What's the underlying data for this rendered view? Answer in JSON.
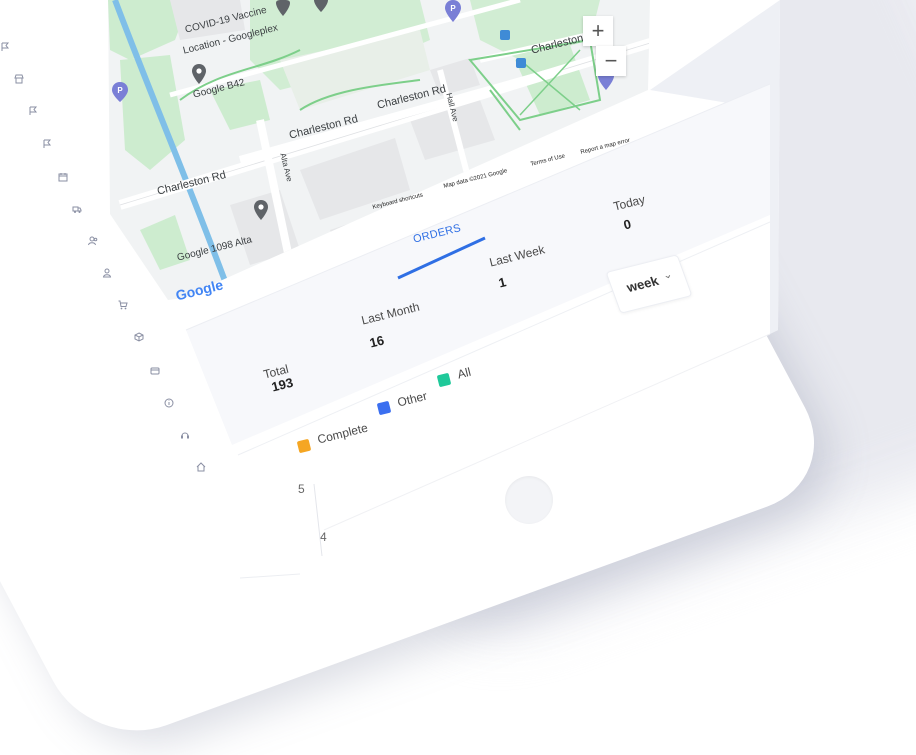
{
  "map": {
    "labels": {
      "covid_vaccine": "COVID-19 Vaccine",
      "location_googleplex": "Location - Googleplex",
      "google_b42": "Google B42",
      "charleston_rd_1": "Charleston Rd",
      "charleston_rd_2": "Charleston Rd",
      "charleston_rd_3": "Charleston Rd",
      "charleston_rd_4": "Charleston",
      "alta_ave": "Alta Ave",
      "hall_ave": "Hall Ave",
      "google_1098_alta": "Google 1098 Alta",
      "google_logo": "Google",
      "keyboard_shortcuts": "Keyboard shortcuts",
      "map_data": "Map data ©2021 Google",
      "terms_of_use": "Terms of Use",
      "report_map_error": "Report a map error"
    },
    "zoom_in": "+",
    "zoom_out": "−"
  },
  "panel": {
    "tab_orders": "ORDERS",
    "stats": {
      "today_label": "Today",
      "today_value": "0",
      "last_week_label": "Last Week",
      "last_week_value": "1",
      "last_month_label": "Last Month",
      "last_month_value": "16",
      "total_label": "Total",
      "total_value": "193"
    },
    "period_select": "week",
    "legend": [
      {
        "label": "Complete",
        "color": "#f5a623"
      },
      {
        "label": "Other",
        "color": "#3b6ff0"
      },
      {
        "label": "All",
        "color": "#1fc99a"
      }
    ],
    "chart_axis": [
      "5",
      "4"
    ]
  },
  "colors": {
    "accent": "#2f6fe4",
    "map_green": "#cdeccf",
    "road": "#ffffff",
    "water": "#7fbfe8"
  }
}
